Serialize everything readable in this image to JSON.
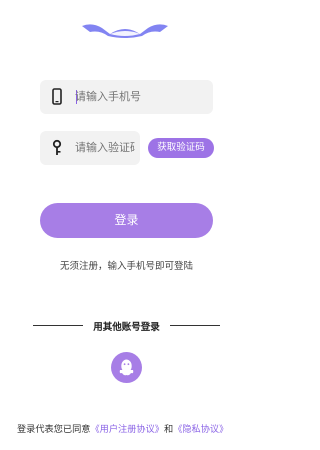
{
  "login_form": {
    "phone_placeholder": "请输入手机号",
    "code_placeholder": "请输入验证码",
    "get_code_label": "获取验证码",
    "submit_label": "登录",
    "hint": "无须注册，输入手机号即可登陆"
  },
  "third_party": {
    "title": "用其他账号登录",
    "qq_icon": "qq-icon"
  },
  "agreement": {
    "prefix": "登录代表您已同意",
    "user_agreement": "《用户注册协议》",
    "and": "和",
    "privacy_agreement": "《隐私协议》"
  },
  "colors": {
    "accent": "#a77ee6",
    "field_bg": "#f2f2f2",
    "link": "#8a63e6"
  }
}
